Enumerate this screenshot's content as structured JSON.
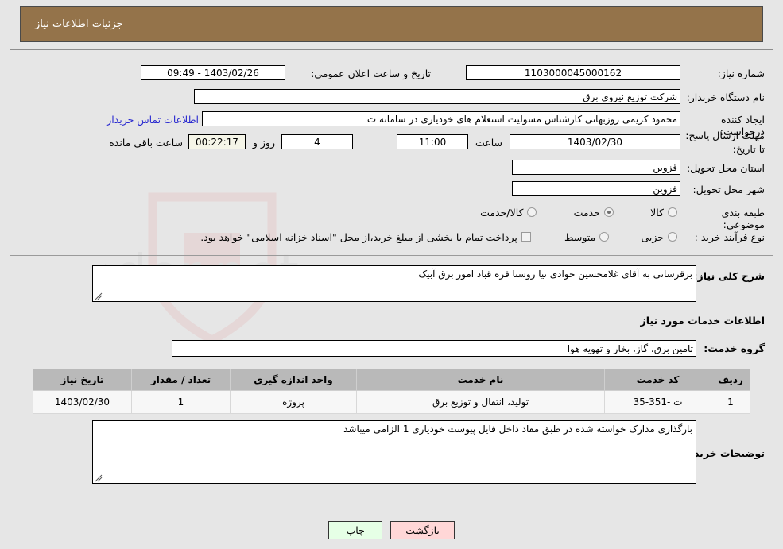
{
  "header": {
    "title": "جزئیات اطلاعات نیاز"
  },
  "form": {
    "need_number_label": "شماره نیاز:",
    "need_number_value": "1103000045000162",
    "announce_label": "تاریخ و ساعت اعلان عمومی:",
    "announce_value": "1403/02/26 - 09:49",
    "buyer_org_label": "نام دستگاه خریدار:",
    "buyer_org_value": "شرکت توزیع نیروی برق",
    "creator_label": "ایجاد کننده درخواست:",
    "creator_value": "محمود کریمی روزبهانی کارشناس  مسولیت استعلام های خودیاری در سامانه ت",
    "buyer_contact_link": "اطلاعات تماس خریدار",
    "deadline_label": "مهلت ارسال پاسخ: تا تاریخ:",
    "deadline_date": "1403/02/30",
    "hour_label": "ساعت",
    "deadline_time": "11:00",
    "days_value": "4",
    "days_label": "روز و",
    "countdown_value": "00:22:17",
    "remaining_label": "ساعت باقی مانده",
    "province_label": "استان محل تحویل:",
    "province_value": "قزوین",
    "city_label": "شهر محل تحویل:",
    "city_value": "قزوین",
    "category_label": "طبقه بندی موضوعی:",
    "category_options": [
      {
        "label": "کالا",
        "checked": false
      },
      {
        "label": "خدمت",
        "checked": true
      },
      {
        "label": "کالا/خدمت",
        "checked": false
      }
    ],
    "process_label": "نوع فرآیند خرید :",
    "process_options": [
      {
        "label": "جزیی",
        "checked": false
      },
      {
        "label": "متوسط",
        "checked": false
      }
    ],
    "treasury_checkbox_checked": false,
    "treasury_text": "پرداخت تمام یا بخشی از مبلغ خرید،از محل \"اسناد خزانه اسلامی\" خواهد بود."
  },
  "need_description": {
    "label": "شرح کلی نیاز:",
    "value": "برقرسانی به آقای غلامحسین جوادی نیا روستا قره قباد امور برق آبیک"
  },
  "services_section": {
    "title": "اطلاعات خدمات مورد نیاز",
    "group_label": "گروه خدمت:",
    "group_value": "تامین برق، گاز، بخار و تهویه هوا"
  },
  "table": {
    "columns": [
      "ردیف",
      "کد خدمت",
      "نام خدمت",
      "واحد اندازه گیری",
      "تعداد / مقدار",
      "تاریخ نیاز"
    ],
    "rows": [
      {
        "row_no": "1",
        "service_code": "ت -351-35",
        "service_name": "تولید، انتقال و توزیع برق",
        "unit": "پروژه",
        "quantity": "1",
        "need_date": "1403/02/30"
      }
    ]
  },
  "buyer_notes": {
    "label": "توضیحات خریدار:",
    "value": "بارگذاری مدارک خواسته شده در طبق مفاد داخل فایل پیوست خودیاری 1 الزامی میباشد"
  },
  "footer": {
    "print_label": "چاپ",
    "back_label": "بازگشت"
  },
  "watermark": {
    "text": "AriaTender.net"
  },
  "colors": {
    "header_bg": "#94734a",
    "link": "#2a2ad0",
    "print_btn": "#e6ffe6",
    "back_btn": "#ffd7d7",
    "table_header": "#b9b9b9",
    "page_bg": "#e6e6e6"
  }
}
